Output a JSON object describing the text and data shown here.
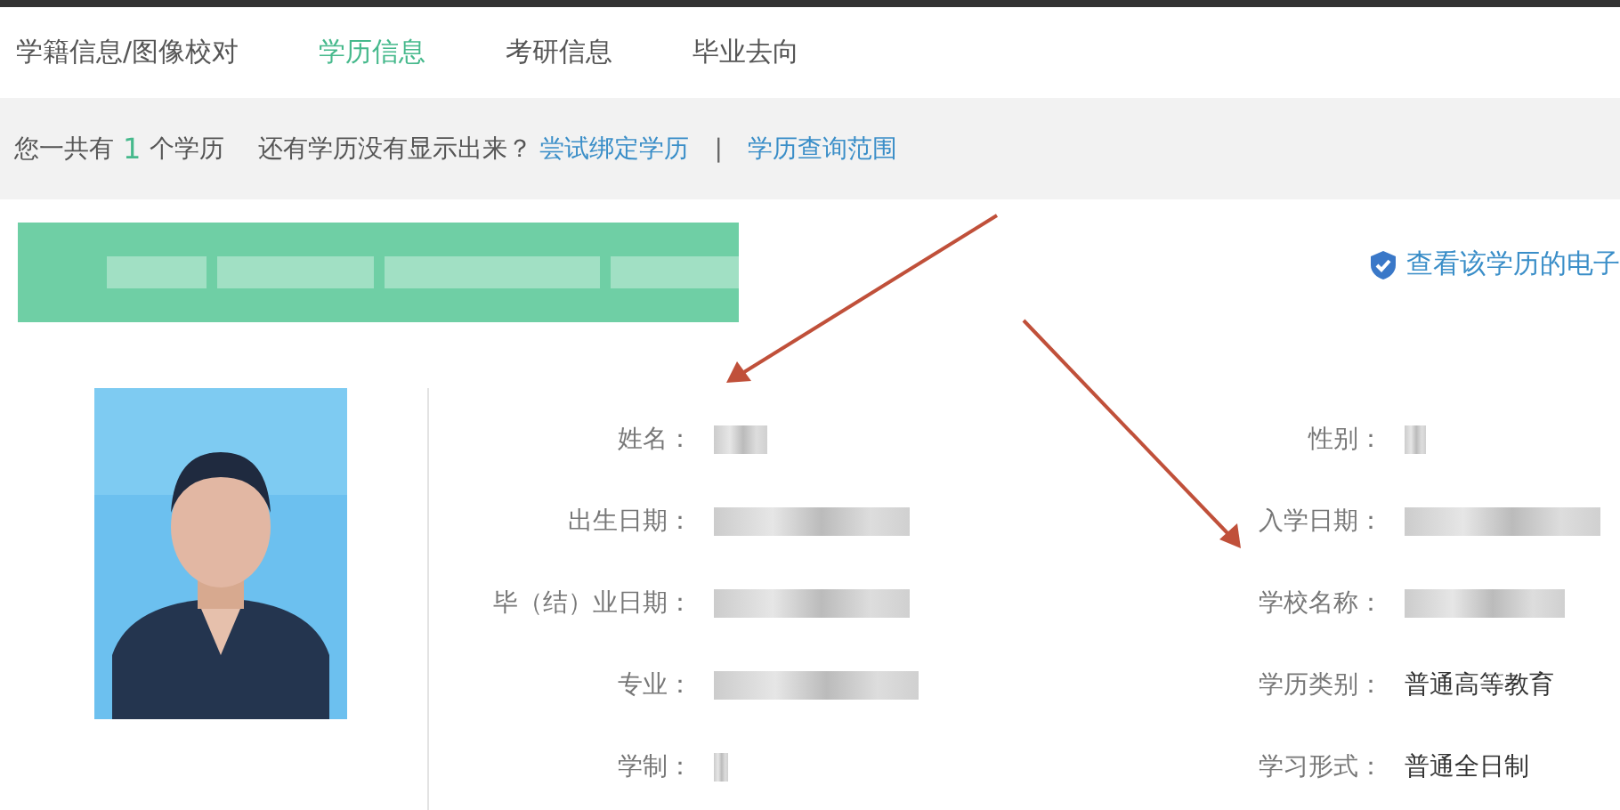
{
  "tabs": [
    {
      "label": "学籍信息/图像校对",
      "selected": false
    },
    {
      "label": "学历信息",
      "selected": true
    },
    {
      "label": "考研信息",
      "selected": false
    },
    {
      "label": "毕业去向",
      "selected": false
    }
  ],
  "summary": {
    "prefix": "您一共有",
    "count": "1",
    "suffix": "个学历",
    "question": "还有学历没有显示出来？",
    "links": [
      "尝试绑定学历",
      "学历查询范围"
    ],
    "separator": "|"
  },
  "record": {
    "header": {
      "redacted": true
    },
    "certificate_link": "查看该学历的电子",
    "left_fields": [
      {
        "label": "姓名：",
        "redacted": true
      },
      {
        "label": "出生日期：",
        "redacted": true
      },
      {
        "label": "毕（结）业日期：",
        "redacted": true
      },
      {
        "label": "专业：",
        "redacted": true
      },
      {
        "label": "学制：",
        "redacted": true
      }
    ],
    "right_fields": [
      {
        "label": "性别：",
        "redacted": true
      },
      {
        "label": "入学日期：",
        "redacted": true
      },
      {
        "label": "学校名称：",
        "redacted": true
      },
      {
        "label": "学历类别：",
        "redacted": false,
        "value": "普通高等教育"
      },
      {
        "label": "学习形式：",
        "redacted": false,
        "value": "普通全日制"
      }
    ]
  }
}
